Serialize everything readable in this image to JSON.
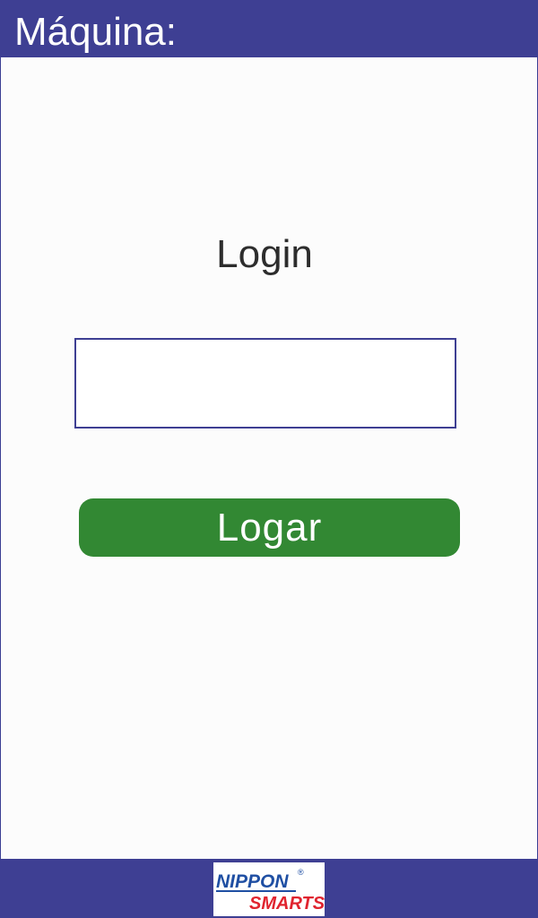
{
  "header": {
    "title": "Máquina:"
  },
  "login": {
    "title": "Login",
    "input_value": "",
    "button_label": "Logar"
  },
  "footer": {
    "logo_top": "NIPPON",
    "logo_bottom": "SMARTS",
    "logo_mark": "®"
  },
  "colors": {
    "header_bg": "#3e3f93",
    "button_bg": "#328833",
    "logo_blue": "#1f4fa3",
    "logo_red": "#e0242f"
  }
}
